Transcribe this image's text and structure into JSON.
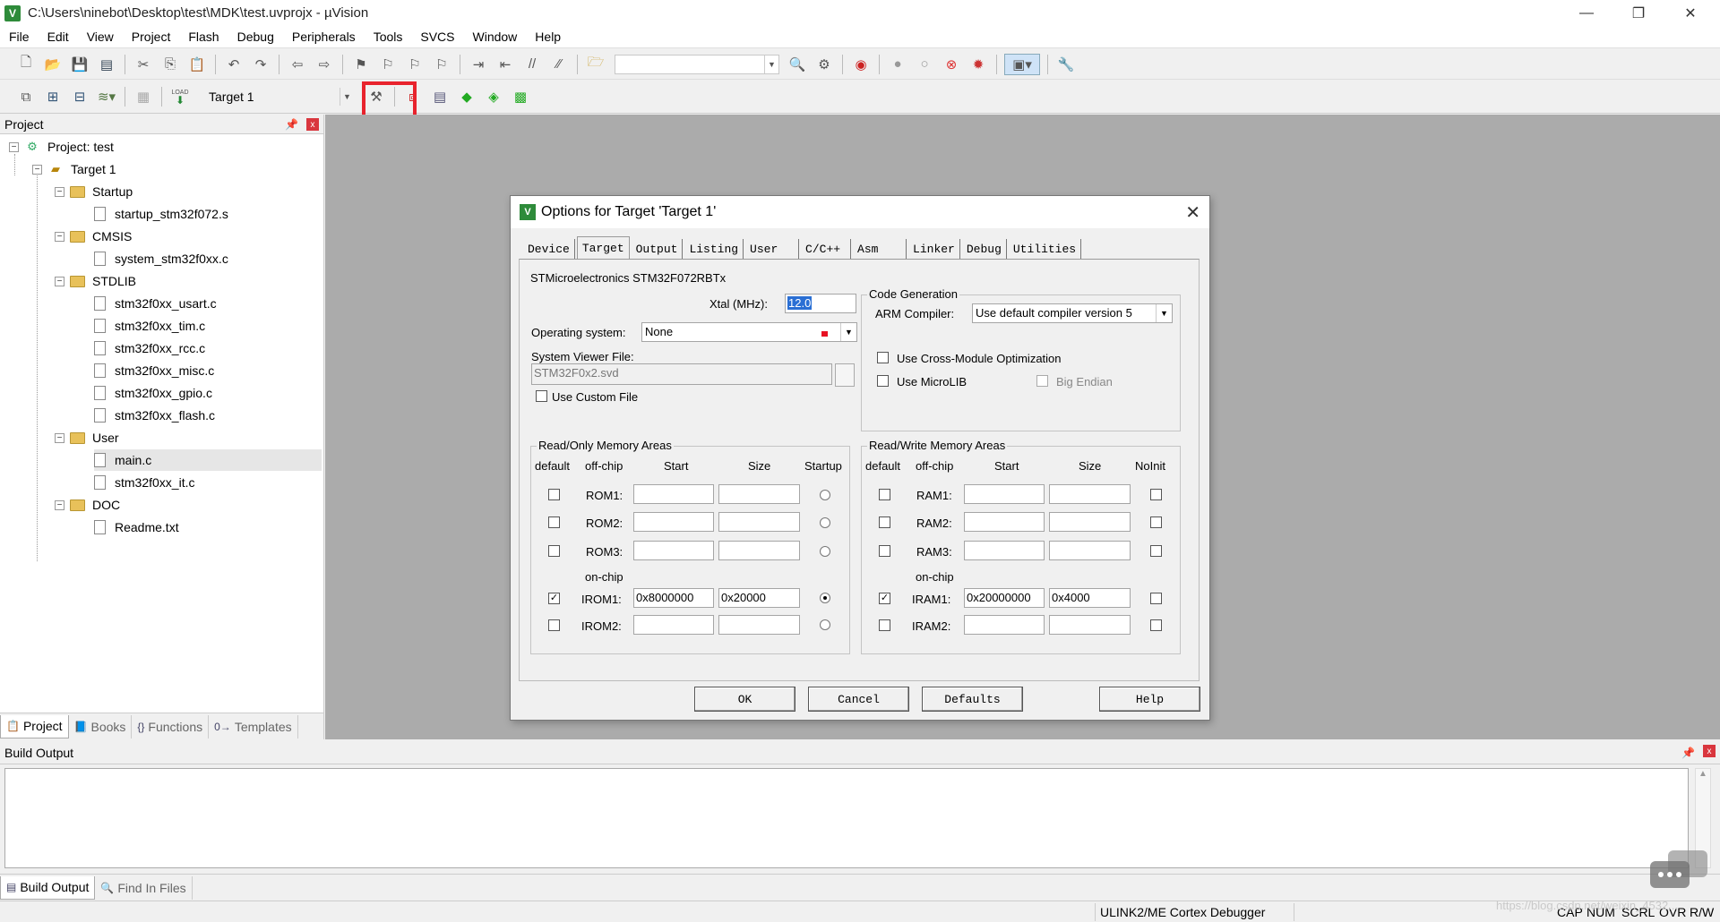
{
  "window": {
    "title": "C:\\Users\\ninebot\\Desktop\\test\\MDK\\test.uvprojx - µVision",
    "app_icon": "V",
    "minimize": "—",
    "restore": "❐",
    "close": "✕"
  },
  "menu": [
    "File",
    "Edit",
    "View",
    "Project",
    "Flash",
    "Debug",
    "Peripherals",
    "Tools",
    "SVCS",
    "Window",
    "Help"
  ],
  "toolbar2": {
    "target_name": "Target 1",
    "load_label": "LOAD"
  },
  "project_pane": {
    "title": "Project",
    "pin": "📌",
    "close": "x",
    "tree": {
      "root": "Project: test",
      "target": "Target 1",
      "groups": [
        {
          "name": "Startup",
          "files": [
            "startup_stm32f072.s"
          ]
        },
        {
          "name": "CMSIS",
          "files": [
            "system_stm32f0xx.c"
          ]
        },
        {
          "name": "STDLIB",
          "files": [
            "stm32f0xx_usart.c",
            "stm32f0xx_tim.c",
            "stm32f0xx_rcc.c",
            "stm32f0xx_misc.c",
            "stm32f0xx_gpio.c",
            "stm32f0xx_flash.c"
          ]
        },
        {
          "name": "User",
          "files": [
            "main.c",
            "stm32f0xx_it.c"
          ]
        },
        {
          "name": "DOC",
          "files": [
            "Readme.txt"
          ]
        }
      ],
      "selected_file": "main.c"
    },
    "tabs": [
      "Project",
      "Books",
      "Functions",
      "Templates"
    ],
    "tab_icons": [
      "📋",
      "📘",
      "{}",
      "0→"
    ]
  },
  "dialog": {
    "title": "Options for Target 'Target 1'",
    "close": "✕",
    "tabs": [
      "Device",
      "Target",
      "Output",
      "Listing",
      "User",
      "C/C++",
      "Asm",
      "Linker",
      "Debug",
      "Utilities"
    ],
    "active_tab": "Target",
    "device_name": "STMicroelectronics STM32F072RBTx",
    "xtal_label": "Xtal (MHz):",
    "xtal_value": "12.0",
    "os_label": "Operating system:",
    "os_value": "None",
    "svf_label": "System Viewer File:",
    "svf_value": "STM32F0x2.svd",
    "use_custom_file": "Use Custom File",
    "code_gen": {
      "title": "Code Generation",
      "compiler_label": "ARM Compiler:",
      "compiler_value": "Use default compiler version 5",
      "cross_module": "Use Cross-Module Optimization",
      "microlib": "Use MicroLIB",
      "big_endian": "Big Endian"
    },
    "ro_memory": {
      "title": "Read/Only Memory Areas",
      "headers": [
        "default",
        "off-chip",
        "Start",
        "Size",
        "Startup"
      ],
      "offchip_rows": [
        {
          "label": "ROM1:",
          "start": "",
          "size": "",
          "checked": false,
          "startup": false
        },
        {
          "label": "ROM2:",
          "start": "",
          "size": "",
          "checked": false,
          "startup": false
        },
        {
          "label": "ROM3:",
          "start": "",
          "size": "",
          "checked": false,
          "startup": false
        }
      ],
      "onchip_label": "on-chip",
      "onchip_rows": [
        {
          "label": "IROM1:",
          "start": "0x8000000",
          "size": "0x20000",
          "checked": true,
          "startup": true
        },
        {
          "label": "IROM2:",
          "start": "",
          "size": "",
          "checked": false,
          "startup": false
        }
      ]
    },
    "rw_memory": {
      "title": "Read/Write Memory Areas",
      "headers": [
        "default",
        "off-chip",
        "Start",
        "Size",
        "NoInit"
      ],
      "offchip_rows": [
        {
          "label": "RAM1:",
          "start": "",
          "size": "",
          "checked": false,
          "noinit": false
        },
        {
          "label": "RAM2:",
          "start": "",
          "size": "",
          "checked": false,
          "noinit": false
        },
        {
          "label": "RAM3:",
          "start": "",
          "size": "",
          "checked": false,
          "noinit": false
        }
      ],
      "onchip_label": "on-chip",
      "onchip_rows": [
        {
          "label": "IRAM1:",
          "start": "0x20000000",
          "size": "0x4000",
          "checked": true,
          "noinit": false
        },
        {
          "label": "IRAM2:",
          "start": "",
          "size": "",
          "checked": false,
          "noinit": false
        }
      ]
    },
    "buttons": {
      "ok": "OK",
      "cancel": "Cancel",
      "defaults": "Defaults",
      "help": "Help"
    }
  },
  "build_output": {
    "title": "Build Output",
    "pin": "📌",
    "close": "x",
    "tabs": [
      "Build Output",
      "Find In Files"
    ]
  },
  "statusbar": {
    "debugger": "ULINK2/ME Cortex Debugger",
    "indicators": [
      "CAP",
      "NUM",
      "SCRL",
      "OVR",
      "R/W"
    ]
  },
  "watermark": "https://blog.csdn.net/weixin_4532..."
}
